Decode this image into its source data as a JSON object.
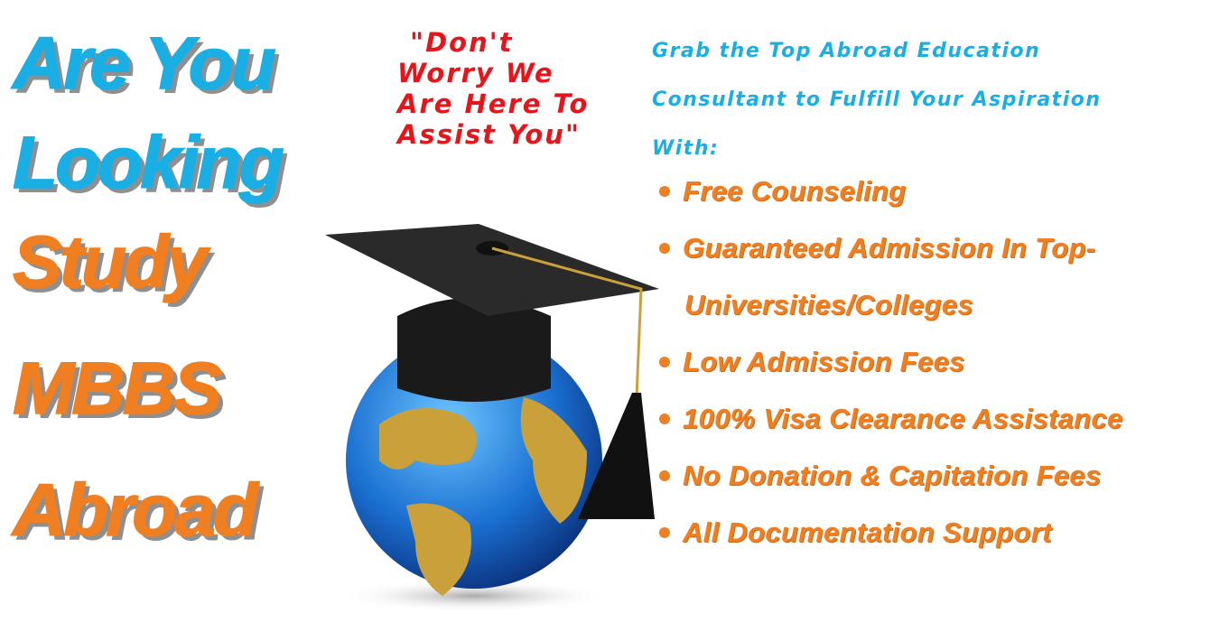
{
  "headline": {
    "line1": "Are You",
    "line2": "Looking",
    "line3": "Study",
    "line4": "MBBS",
    "line5": "Abroad"
  },
  "quote": {
    "line1": "\"Don't",
    "line2": "Worry We",
    "line3": "Are Here To",
    "line4": "Assist You\""
  },
  "intro": {
    "line1": "Grab the Top Abroad Education",
    "line2": "Consultant to Fulfill Your Aspiration",
    "line3": "With:"
  },
  "benefits": [
    "Free Counseling",
    "Guaranteed Admission In Top-",
    "Universities/Colleges",
    "Low Admission Fees",
    "100% Visa Clearance Assistance",
    "No Donation & Capitation Fees",
    "All Documentation Support"
  ],
  "colors": {
    "cyan": "#1aafe4",
    "orange": "#f07f22",
    "red": "#e5151b"
  }
}
